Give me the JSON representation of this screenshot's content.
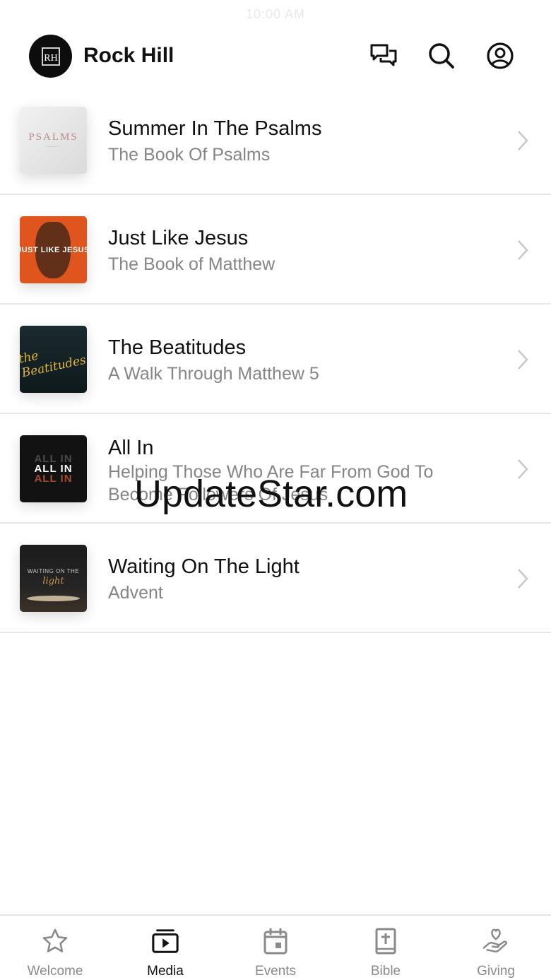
{
  "status_bar": {
    "time": "10:00 AM"
  },
  "header": {
    "logo_text": "RH",
    "title": "Rock Hill",
    "icons": [
      "chat-bubbles-icon",
      "search-icon",
      "profile-icon"
    ]
  },
  "series": [
    {
      "title": "Summer In The Psalms",
      "subtitle": "The Book Of Psalms",
      "thumb": {
        "main": "PSALMS"
      }
    },
    {
      "title": "Just Like Jesus",
      "subtitle": "The Book of Matthew",
      "thumb": {
        "main": "JUST LIKE JESUS"
      }
    },
    {
      "title": "The Beatitudes",
      "subtitle": "A Walk Through Matthew 5",
      "thumb": {
        "main": "the Beatitudes"
      }
    },
    {
      "title": "All In",
      "subtitle": "Helping Those Who Are Far From God To Become Followers Of Jesus",
      "thumb": {
        "line1": "ALL IN",
        "line2": "ALL IN",
        "line3": "ALL IN"
      }
    },
    {
      "title": "Waiting On The Light",
      "subtitle": "Advent",
      "thumb": {
        "main": "WAITING ON THE",
        "script": "light"
      }
    }
  ],
  "watermark": "UpdateStar.com",
  "tabbar": {
    "active": "Media",
    "tabs": [
      {
        "label": "Welcome",
        "icon": "star-icon"
      },
      {
        "label": "Media",
        "icon": "media-player-icon"
      },
      {
        "label": "Events",
        "icon": "calendar-icon"
      },
      {
        "label": "Bible",
        "icon": "bible-icon"
      },
      {
        "label": "Giving",
        "icon": "giving-hand-heart-icon"
      }
    ]
  },
  "colors": {
    "text_primary": "#111111",
    "text_secondary": "#858585",
    "divider": "#e6e6e6",
    "tab_inactive": "#8a8a8a"
  }
}
